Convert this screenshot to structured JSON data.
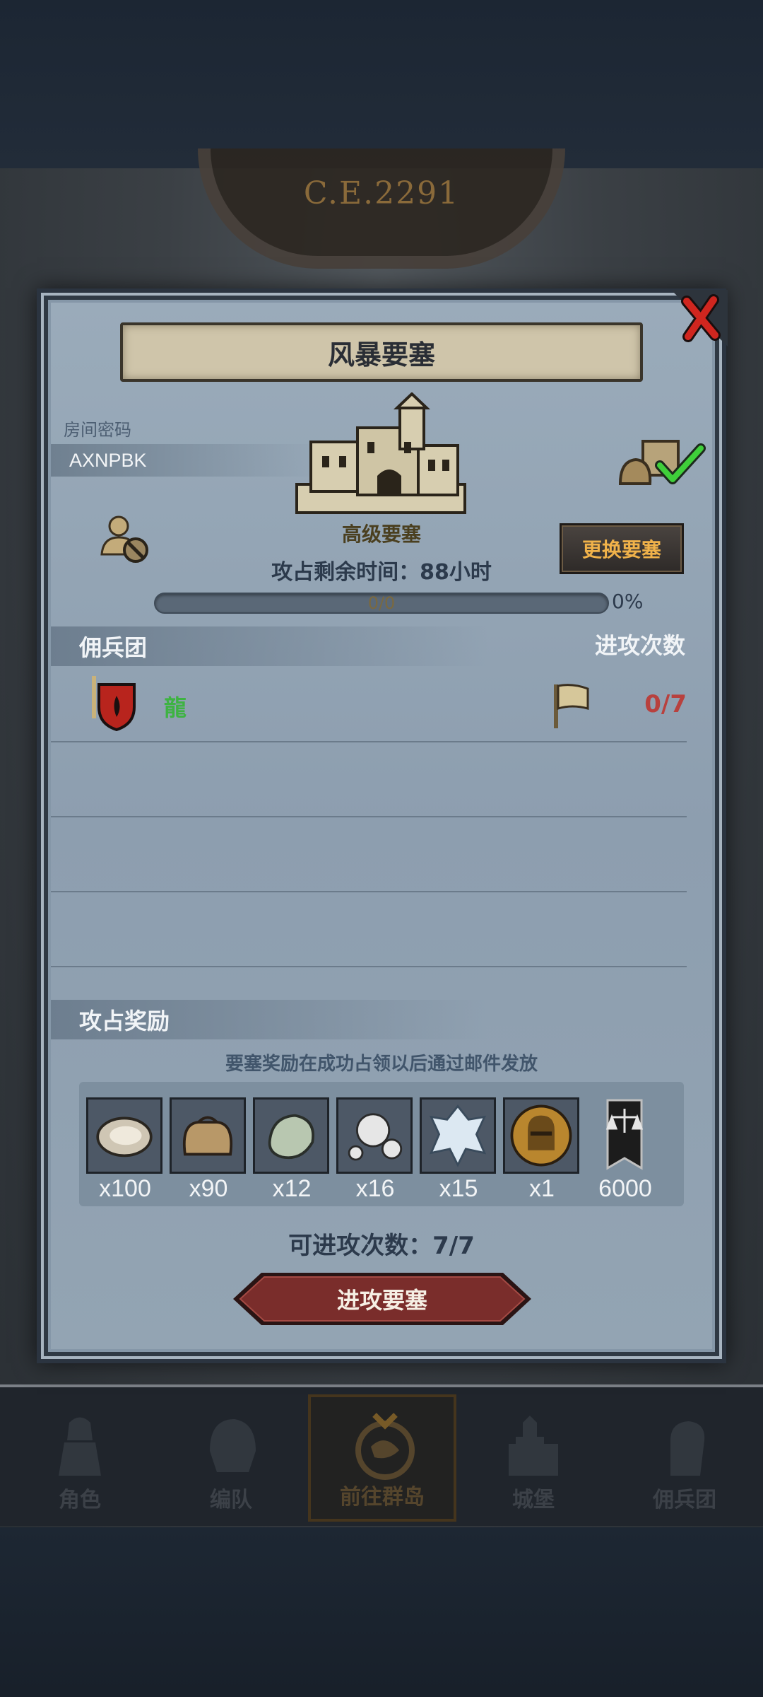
{
  "background": {
    "year": "C.E.2291"
  },
  "panel": {
    "title": "风暴要塞",
    "room_label": "房间密码",
    "room_code": "AXNPBK",
    "fort_level": "高级要塞",
    "change_button": "更换要塞",
    "time_left_label": "攻占剩余时间：",
    "time_left_value": "88",
    "time_left_unit": "小时",
    "progress_text": "0/0",
    "progress_percent": "0%",
    "progress_fraction": 0
  },
  "mercenary": {
    "header": "佣兵团",
    "attack_count_header": "进攻次数",
    "rows": [
      {
        "name": "龍",
        "count": "0/7"
      }
    ]
  },
  "rewards": {
    "header": "攻占奖励",
    "note": "要塞奖励在成功占领以后通过邮件发放",
    "items": [
      {
        "icon": "oyster-icon",
        "qty": "x100"
      },
      {
        "icon": "sack-icon",
        "qty": "x90"
      },
      {
        "icon": "jade-stone-icon",
        "qty": "x12"
      },
      {
        "icon": "pearls-icon",
        "qty": "x16"
      },
      {
        "icon": "ice-crystal-icon",
        "qty": "x15"
      },
      {
        "icon": "knight-helmet-medal-icon",
        "qty": "x1"
      },
      {
        "icon": "scales-banner-icon",
        "qty": "6000"
      }
    ]
  },
  "attack": {
    "available_label": "可进攻次数：",
    "available_value": "7/7",
    "button": "进攻要塞"
  },
  "navbar": {
    "items": [
      {
        "label": "角色",
        "icon": "knight-icon"
      },
      {
        "label": "编队",
        "icon": "helmet-icon"
      },
      {
        "label": "前往群岛",
        "icon": "globe-icon",
        "active": true
      },
      {
        "label": "城堡",
        "icon": "castle-icon"
      },
      {
        "label": "佣兵团",
        "icon": "fist-icon"
      }
    ]
  },
  "colors": {
    "panel_bg": "#8d9eaf",
    "merc_name": "#3eb342",
    "merc_count": "#b8413e",
    "change_button_text": "#f0b24a",
    "attack_button": "#7a2d2b"
  }
}
